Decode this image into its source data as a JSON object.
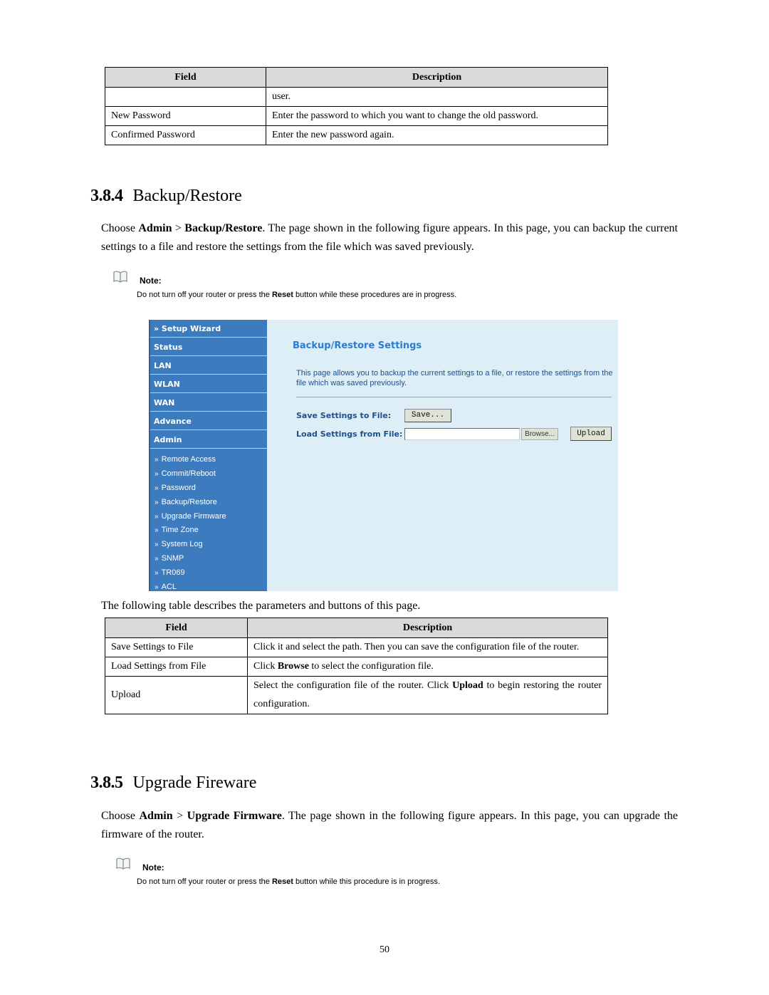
{
  "top_table": {
    "headers": [
      "Field",
      "Description"
    ],
    "rows": [
      {
        "field": "",
        "description": "user."
      },
      {
        "field": "New Password",
        "description": "Enter the password to which you want to change the old password."
      },
      {
        "field": "Confirmed Password",
        "description": "Enter the new password again."
      }
    ]
  },
  "section_backup": {
    "number": "3.8.4",
    "title": "Backup/Restore",
    "intro_prefix": "Choose ",
    "intro_bold1": "Admin",
    "intro_sep": " > ",
    "intro_bold2": "Backup/Restore",
    "intro_suffix": ". The page shown in the following figure appears. In this page, you can backup the current settings to a file and restore the settings from the file which was saved previously.",
    "note_label": "Note:",
    "note_prefix": "Do not turn off your router or press the ",
    "note_bold": "Reset",
    "note_suffix": " button while these procedures are in progress.",
    "note_icon": "book-icon"
  },
  "router_ui": {
    "nav_items": [
      "» Setup Wizard",
      "Status",
      "LAN",
      "WLAN",
      "WAN",
      "Advance",
      "Admin"
    ],
    "sub_arrow": "»",
    "sub_items": [
      "Remote Access",
      "Commit/Reboot",
      "Password",
      "Backup/Restore",
      "Upgrade Firmware",
      "Time Zone",
      "System Log",
      "SNMP",
      "TR069",
      "ACL"
    ],
    "page_title": "Backup/Restore Settings",
    "page_desc": "This page allows you to backup the current settings to a file, or restore the settings from the file which was saved previously.",
    "save_label": "Save Settings to File:",
    "save_button": "Save...",
    "load_label": "Load Settings from File:",
    "file_input_value": "",
    "browse_button": "Browse...",
    "upload_button": "Upload",
    "colors": {
      "nav_bg": "#3d7bbf",
      "content_bg": "#ddeef6",
      "title": "#2b7bd0",
      "label": "#1e4f8d"
    }
  },
  "mid_caption": "The following table describes the parameters and buttons of this page.",
  "params_table": {
    "headers": [
      "Field",
      "Description"
    ],
    "rows": [
      {
        "field": "Save Settings to File",
        "desc_prefix": "Click it and select the path. Then you can save the configuration file of the router.",
        "desc_bold": "",
        "desc_suffix": ""
      },
      {
        "field": "Load Settings from File",
        "desc_prefix": "Click ",
        "desc_bold": "Browse",
        "desc_suffix": " to select the configuration file."
      },
      {
        "field": "Upload",
        "desc_prefix": "Select the configuration file of the router. Click ",
        "desc_bold": "Upload",
        "desc_suffix": " to begin restoring the router configuration."
      }
    ]
  },
  "section_upgrade": {
    "number": "3.8.5",
    "title": "Upgrade Fireware",
    "intro_prefix": "Choose ",
    "intro_bold1": "Admin",
    "intro_sep": " > ",
    "intro_bold2": "Upgrade Firmware",
    "intro_suffix": ". The page shown in the following figure appears. In this page, you can upgrade the firmware of the router.",
    "note_label": "Note:",
    "note_prefix": "Do not turn off your router or press the ",
    "note_bold": "Reset",
    "note_suffix": " button while this procedure is in progress.",
    "note_icon": "book-icon"
  },
  "page_number": "50"
}
